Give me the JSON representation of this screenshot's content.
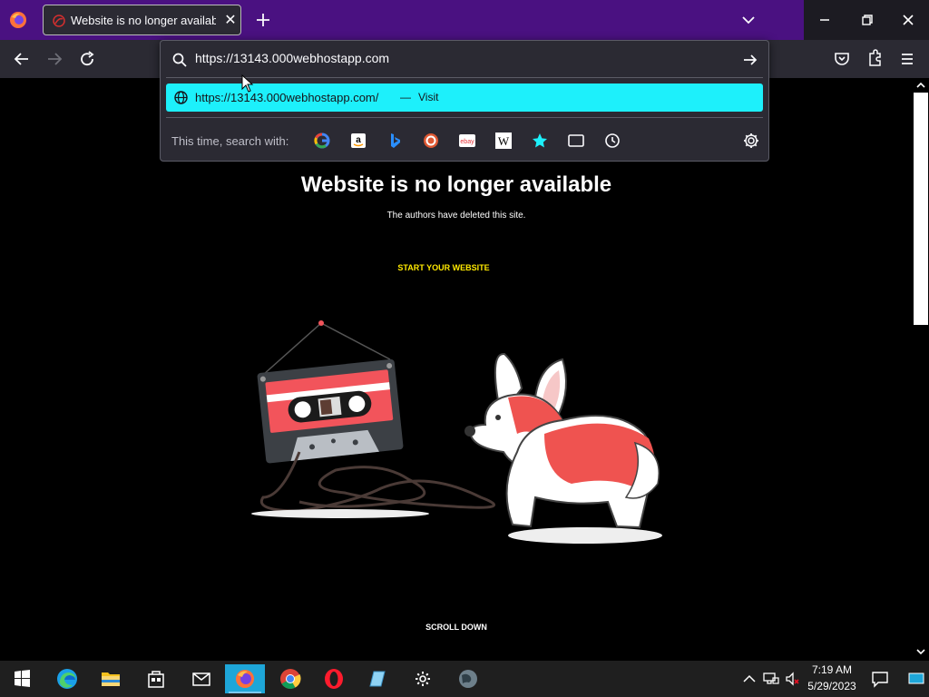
{
  "browser": {
    "tab_title": "Website is no longer available |",
    "url_typed": "https://13143.000webhostapp.com",
    "suggestion_url": "https://13143.000webhostapp.com/",
    "suggestion_dash": "—",
    "suggestion_action": "Visit",
    "search_with_label": "This time, search with:",
    "engines": [
      "google-icon",
      "amazon-icon",
      "bing-icon",
      "duckduckgo-icon",
      "ebay-icon",
      "wikipedia-icon",
      "bookmarks-icon",
      "tabs-icon",
      "history-icon"
    ]
  },
  "page": {
    "headline": "Website is no longer available",
    "subline": "The authors have deleted this site.",
    "cta": "START YOUR WEBSITE",
    "scroll": "SCROLL DOWN"
  },
  "taskbar": {
    "time": "7:19 AM",
    "date": "5/29/2023"
  },
  "colors": {
    "tabbar": "#4a1181",
    "suggestion_highlight": "#1df0fb",
    "cta": "#ffe900",
    "cassette": "#f2545b",
    "corgi": "#ef5350"
  }
}
